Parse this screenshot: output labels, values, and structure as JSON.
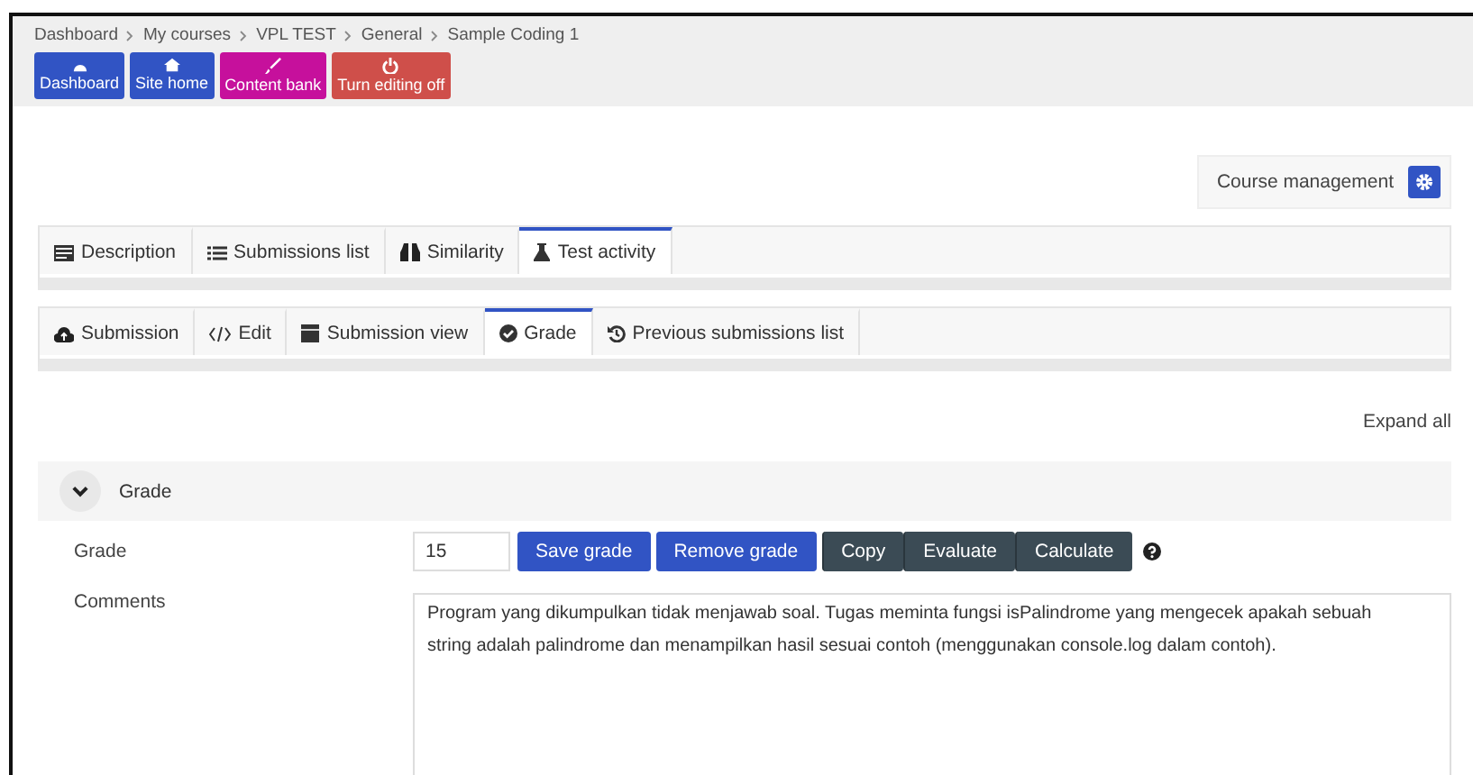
{
  "breadcrumb": [
    "Dashboard",
    "My courses",
    "VPL TEST",
    "General",
    "Sample Coding 1"
  ],
  "quick_links": [
    {
      "label": "Dashboard",
      "color": "#3154c4"
    },
    {
      "label": "Site home",
      "color": "#3154c4"
    },
    {
      "label": "Content bank",
      "color": "#c6109c"
    },
    {
      "label": "Turn editing off",
      "color": "#cf4f4a"
    }
  ],
  "course_management": {
    "label": "Course management"
  },
  "tabs": [
    {
      "label": "Description",
      "selected": false
    },
    {
      "label": "Submissions list",
      "selected": false
    },
    {
      "label": "Similarity",
      "selected": false
    },
    {
      "label": "Test activity",
      "selected": true
    }
  ],
  "subtabs": [
    {
      "label": "Submission",
      "selected": false
    },
    {
      "label": "Edit",
      "selected": false
    },
    {
      "label": "Submission view",
      "selected": false
    },
    {
      "label": "Grade",
      "selected": true
    },
    {
      "label": "Previous submissions list",
      "selected": false
    }
  ],
  "expand_all": "Expand all",
  "section": {
    "title": "Grade",
    "expanded": true
  },
  "grade": {
    "label": "Grade",
    "value": "15",
    "buttons": [
      {
        "label": "Save grade",
        "kind": "primary"
      },
      {
        "label": "Remove grade",
        "kind": "primary"
      },
      {
        "label": "Copy",
        "kind": "secondary"
      },
      {
        "label": "Evaluate",
        "kind": "secondary"
      },
      {
        "label": "Calculate",
        "kind": "secondary"
      }
    ]
  },
  "comments": {
    "label": "Comments",
    "value": "Program yang dikumpulkan tidak menjawab soal. Tugas meminta fungsi isPalindrome yang mengecek apakah sebuah string adalah palindrome dan menampilkan hasil sesuai contoh (menggunakan console.log dalam contoh)."
  }
}
